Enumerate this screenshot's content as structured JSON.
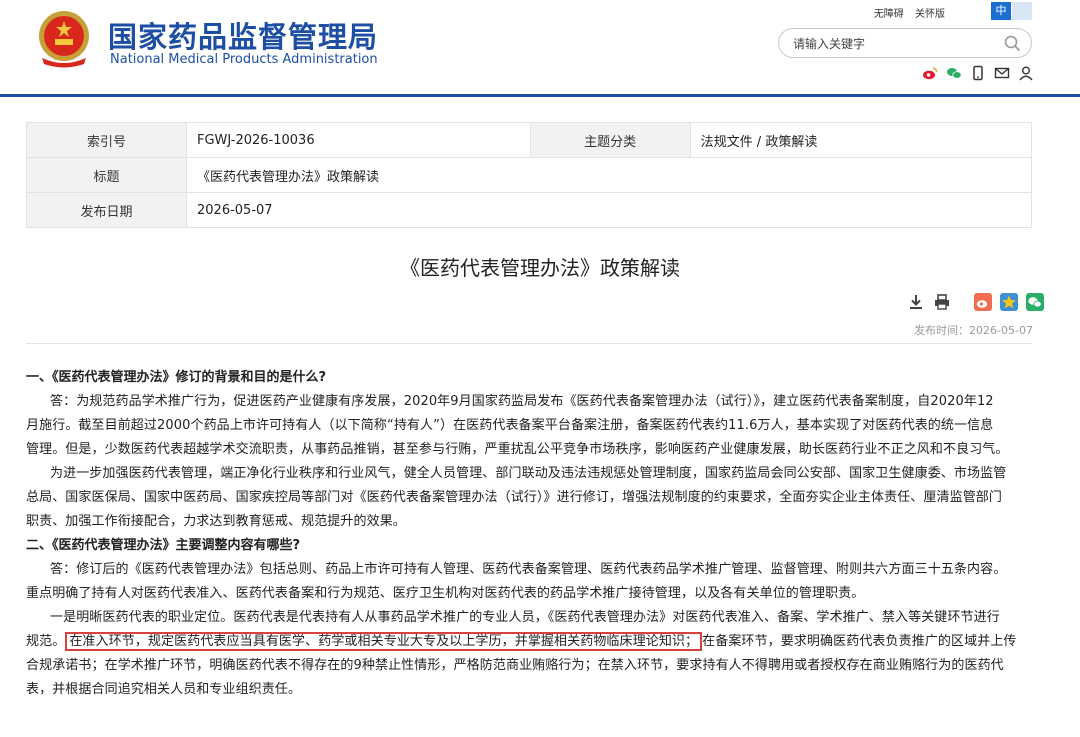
{
  "site": {
    "name_cn": "国家药品监督管理局",
    "name_en": "National Medical Products Administration",
    "top_links": [
      "无障碍",
      "关怀版"
    ],
    "lang_active": "中",
    "lang_other": "",
    "search_placeholder": "请输入关键字",
    "social_icons": [
      "weibo-icon",
      "wechat-icon",
      "mobile-icon",
      "mail-icon",
      "user-icon"
    ],
    "brand_color": "#1c4fa3"
  },
  "meta": {
    "index_label": "索引号",
    "index_value": "FGWJ-2026-10036",
    "category_label": "主题分类",
    "category_value": "法规文件 / 政策解读",
    "title_label": "标题",
    "title_value": "《医药代表管理办法》政策解读",
    "date_label": "发布日期",
    "date_value": "2026-05-07"
  },
  "article": {
    "title": "《医药代表管理办法》政策解读",
    "pub_label": "发布时间：2026-05-07",
    "tool_icons": [
      "download-icon",
      "print-icon",
      "share-weibo-icon",
      "favorite-icon",
      "share-wechat-icon"
    ],
    "q1": "一、《医药代表管理办法》修订的背景和目的是什么?",
    "p1": [
      "答：为规范药品学术推广行为，促进医药产业健康有序发展，2020年9月国家药监局发布《医药代表备案管理办法（试行）》，建立医药代表备案制度，自2020年12",
      "月施行。截至目前超过2000个药品上市许可持有人（以下简称“持有人”）在医药代表备案平台备案注册，备案医药代表约11.6万人，基本实现了对医药代表的统一信息",
      "管理。但是，少数医药代表超越学术交流职责，从事药品推销，甚至参与行贿，严重扰乱公平竞争市场秩序，影响医药产业健康发展，助长医药行业不正之风和不良习气。"
    ],
    "p2": [
      "为进一步加强医药代表管理，端正净化行业秩序和行业风气，健全人员管理、部门联动及违法违规惩处管理制度，国家药监局会同公安部、国家卫生健康委、市场监管",
      "总局、国家医保局、国家中医药局、国家疾控局等部门对《医药代表备案管理办法（试行）》进行修订，增强法规制度的约束要求，全面夯实企业主体责任、厘清监管部门",
      "职责、加强工作衔接配合，力求达到教育惩戒、规范提升的效果。"
    ],
    "q2": "二、《医药代表管理办法》主要调整内容有哪些?",
    "p3": [
      "答：修订后的《医药代表管理办法》包括总则、药品上市许可持有人管理、医药代表备案管理、医药代表药品学术推广管理、监督管理、附则共六方面三十五条内容。",
      "重点明确了持有人对医药代表准入、医药代表备案和行为规范、医疗卫生机构对医药代表的药品学术推广接待管理，以及各有关单位的管理职责。"
    ],
    "p4_line1": "一是明晰医药代表的职业定位。医药代表是代表持有人从事药品学术推广的专业人员，《医药代表管理办法》对医药代表准入、备案、学术推广、禁入等关键环节进行",
    "p4_line2_pre": "规范。",
    "p4_line2_hl": "在准入环节，规定医药代表应当具有医学、药学或相关专业大专及以上学历，并掌握相关药物临床理论知识；",
    "p4_line2_post": "在备案环节，要求明确医药代表负责推广的区域并上传",
    "p4_rest": [
      "合规承诺书；在学术推广环节，明确医药代表不得存在的9种禁止性情形，严格防范商业贿赂行为；在禁入环节，要求持有人不得聘用或者授权存在商业贿赂行为的医药代",
      "表，并根据合同追究相关人员和专业组织责任。"
    ],
    "highlight_color": "#d94141"
  }
}
